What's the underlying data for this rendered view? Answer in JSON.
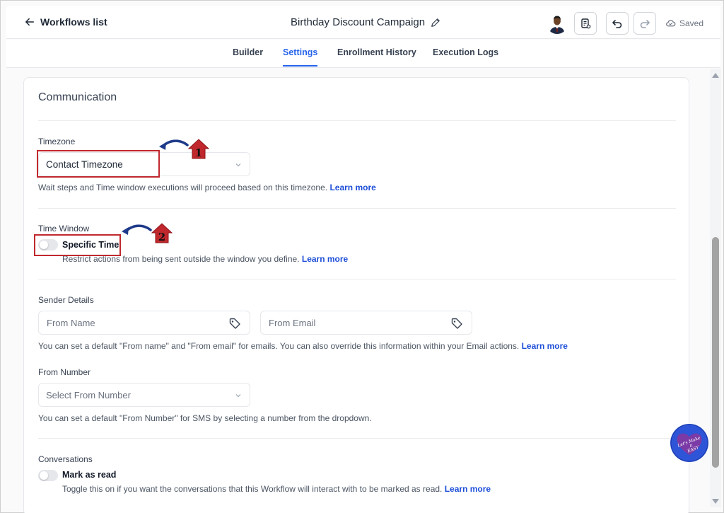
{
  "header": {
    "back_label": "Workflows list",
    "title": "Birthday Discount Campaign",
    "saved_label": "Saved"
  },
  "tabs": [
    {
      "label": "Builder",
      "active": false
    },
    {
      "label": "Settings",
      "active": true
    },
    {
      "label": "Enrollment History",
      "active": false
    },
    {
      "label": "Execution Logs",
      "active": false
    }
  ],
  "section": {
    "title": "Communication"
  },
  "timezone": {
    "label": "Timezone",
    "value": "Contact Timezone",
    "help": "Wait steps and Time window executions will proceed based on this timezone.",
    "link": "Learn more"
  },
  "time_window": {
    "label": "Time Window",
    "toggle_label": "Specific Time",
    "toggle_on": false,
    "help": "Restrict actions from being sent outside the window you define.",
    "link": "Learn more"
  },
  "sender_details": {
    "label": "Sender Details",
    "from_name_placeholder": "From Name",
    "from_email_placeholder": "From Email",
    "help": "You can set a default \"From name\" and \"From email\" for emails. You can also override this information within your Email actions.",
    "link": "Learn more"
  },
  "from_number": {
    "label": "From Number",
    "placeholder": "Select From Number",
    "help": "You can set a default \"From Number\" for SMS by selecting a number from the dropdown."
  },
  "conversations": {
    "label": "Conversations",
    "toggle_label": "Mark as read",
    "toggle_on": false,
    "help": "Toggle this on if you want the conversations that this Workflow will interact with to be marked as read.",
    "link": "Learn more"
  },
  "annotations": {
    "marker_1": "1",
    "marker_2": "2"
  },
  "watermark": {
    "text": "Let's Make It EASY"
  },
  "colors": {
    "accent": "#2563eb",
    "annotation_red": "#c0282d",
    "annotation_arrow": "#1f3a8a",
    "watermark_bg": "#2e55d8"
  },
  "icons": [
    "arrow-left-icon",
    "pencil-icon",
    "notes-icon",
    "undo-icon",
    "redo-icon",
    "cloud-icon",
    "chevron-down-icon",
    "tag-icon"
  ]
}
